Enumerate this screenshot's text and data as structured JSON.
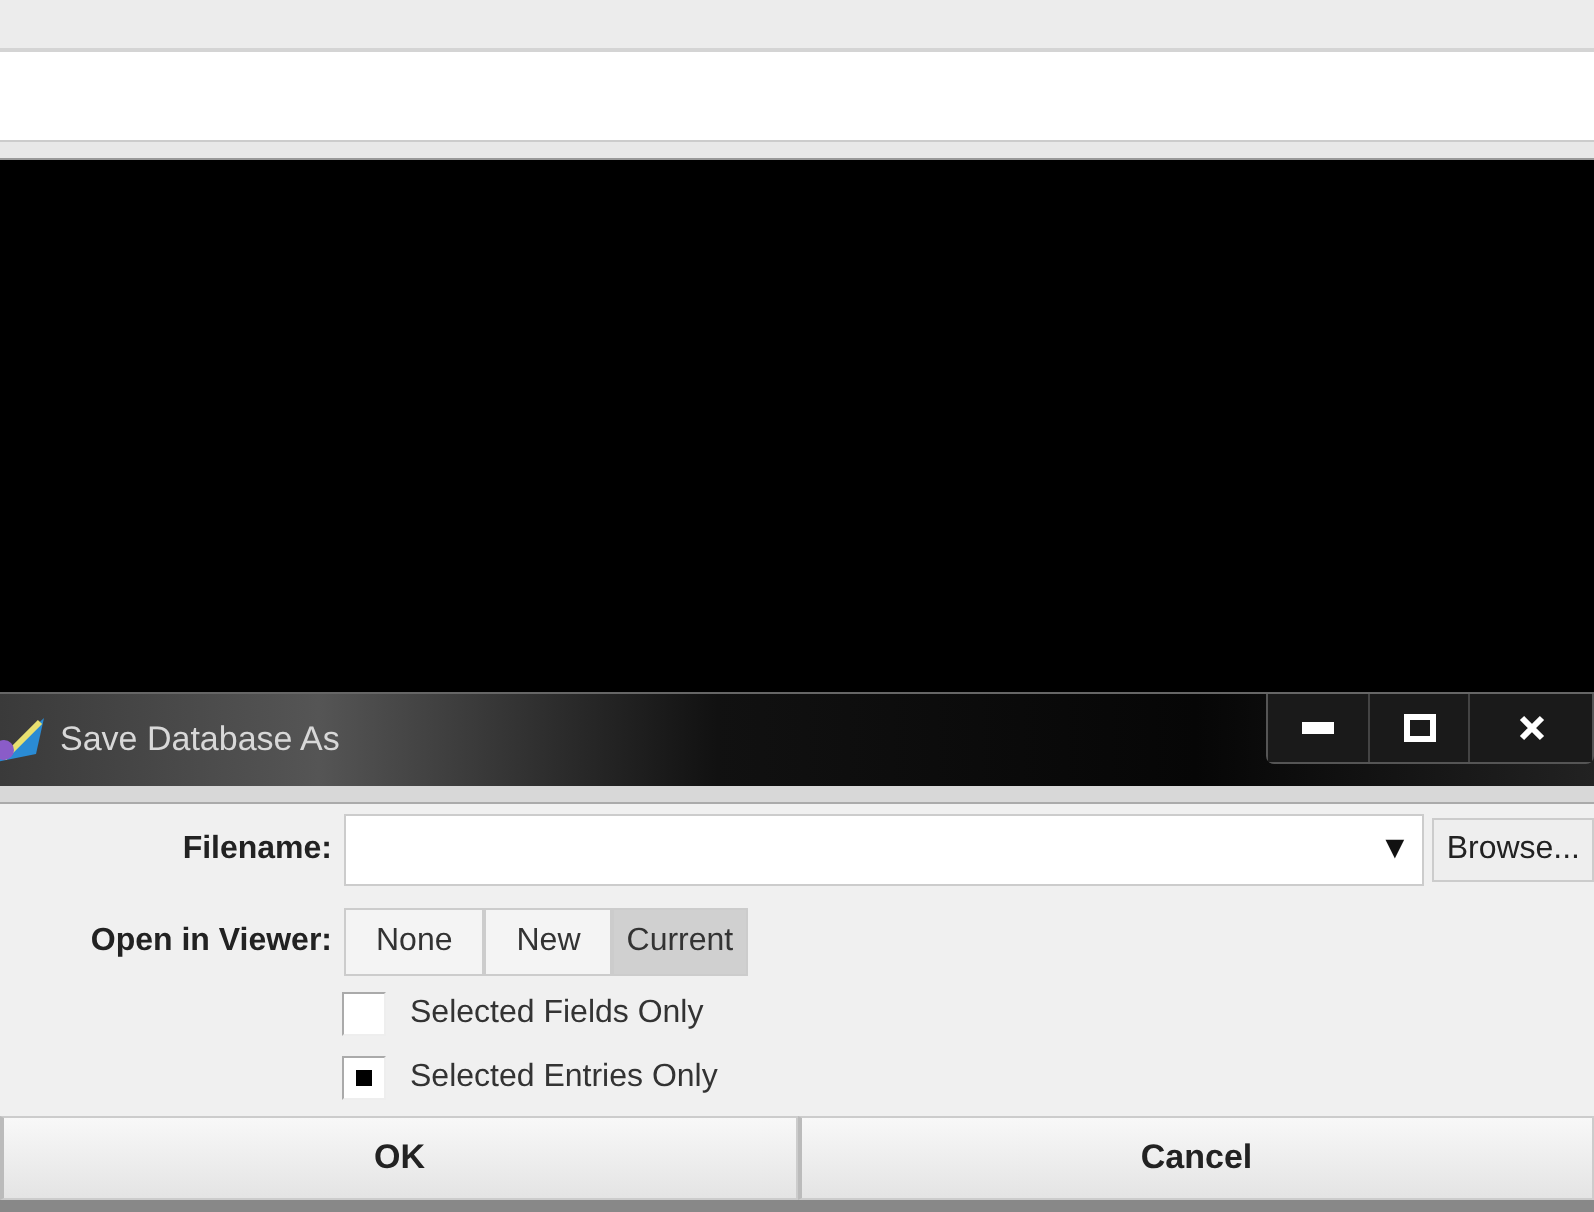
{
  "dialog": {
    "title": "Save Database As",
    "filename": {
      "label": "Filename:",
      "dropdown_arrow": "▼",
      "browse": "Browse..."
    },
    "open_in_viewer": {
      "label": "Open in Viewer:",
      "options": [
        {
          "label": "None",
          "selected": false
        },
        {
          "label": "New",
          "selected": false
        },
        {
          "label": "Current",
          "selected": true
        }
      ]
    },
    "checkboxes": [
      {
        "label": "Selected Fields Only",
        "checked": false
      },
      {
        "label": "Selected Entries Only",
        "checked": true
      }
    ],
    "buttons": [
      "OK",
      "Cancel"
    ]
  }
}
